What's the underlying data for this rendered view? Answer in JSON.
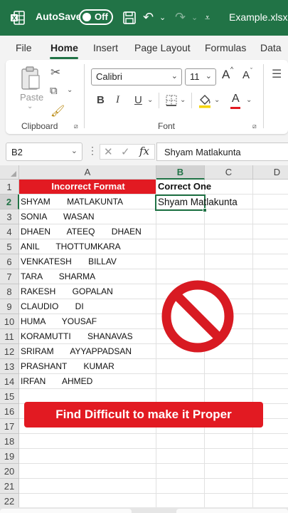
{
  "titlebar": {
    "autosave_label": "AutoSave",
    "autosave_state": "Off",
    "filename": "Example.xlsx"
  },
  "tabs": [
    "File",
    "Home",
    "Insert",
    "Page Layout",
    "Formulas",
    "Data"
  ],
  "ribbon": {
    "paste_label": "Paste",
    "clipboard_label": "Clipboard",
    "font_name": "Calibri",
    "font_size": "11",
    "font_label": "Font",
    "bold": "B",
    "italic": "I",
    "underline": "U",
    "grow_font": "A",
    "shrink_font": "A",
    "font_color": "A"
  },
  "formula_bar": {
    "name_box": "B2",
    "formula": "Shyam Matlakunta"
  },
  "columns": [
    "A",
    "B",
    "C",
    "D"
  ],
  "rows": [
    "1",
    "2",
    "3",
    "4",
    "5",
    "6",
    "7",
    "8",
    "9",
    "10",
    "11",
    "12",
    "13",
    "14",
    "15",
    "16",
    "17",
    "18",
    "19",
    "20",
    "21",
    "22"
  ],
  "cells": {
    "a1": "Incorrect Format",
    "b1": "Correct One",
    "b2": "Shyam Matlakunta",
    "col_a": [
      "SHYAM       MATLAKUNTA",
      "SONIA       WASAN",
      "DHAEN       ATEEQ       DHAEN",
      "ANIL       THOTTUMKARA",
      "VENKATESH       BILLAV",
      "TARA       SHARMA",
      "RAKESH       GOPALAN",
      "CLAUDIO       DI",
      "HUMA       YOUSAF",
      "KORAMUTTI       SHANAVAS",
      "SRIRAM       AYYAPPADSAN",
      "PRASHANT       KUMAR",
      "IRFAN       AHMED"
    ]
  },
  "overlay": {
    "banner": "Find Difficult to make it Proper",
    "sign_color": "#e21a22"
  },
  "colors": {
    "excel_green": "#217346",
    "red": "#e21a22"
  }
}
